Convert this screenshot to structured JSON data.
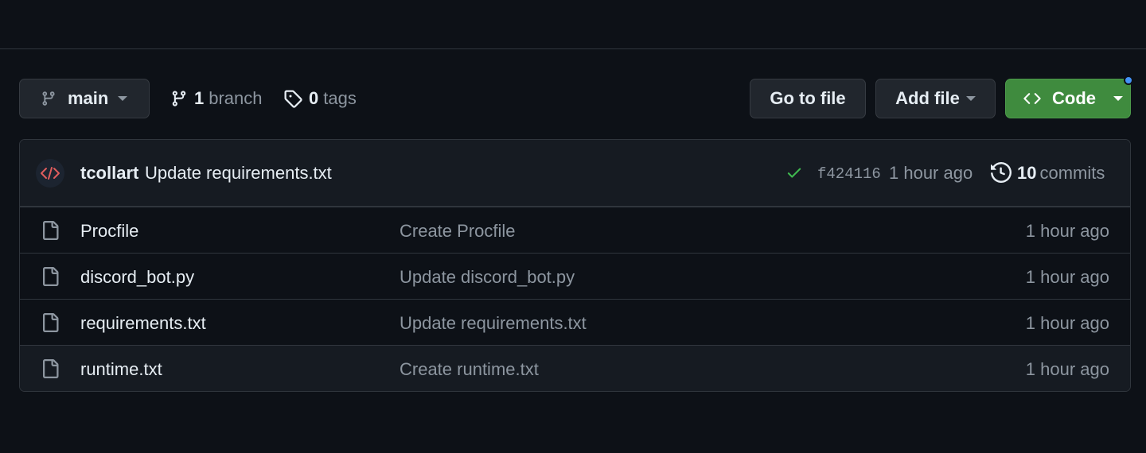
{
  "toolbar": {
    "branch_label": "main",
    "branch_count": "1",
    "branch_word": "branch",
    "tag_count": "0",
    "tag_word": "tags",
    "goto_label": "Go to file",
    "add_label": "Add file",
    "code_label": "Code"
  },
  "commit": {
    "author": "tcollart",
    "message": "Update requirements.txt",
    "sha": "f424116",
    "time": "1 hour ago",
    "commit_count": "10",
    "commit_word": "commits"
  },
  "files": [
    {
      "name": "Procfile",
      "message": "Create Procfile",
      "age": "1 hour ago"
    },
    {
      "name": "discord_bot.py",
      "message": "Update discord_bot.py",
      "age": "1 hour ago"
    },
    {
      "name": "requirements.txt",
      "message": "Update requirements.txt",
      "age": "1 hour ago"
    },
    {
      "name": "runtime.txt",
      "message": "Create runtime.txt",
      "age": "1 hour ago"
    }
  ],
  "colors": {
    "background": "#0d1117",
    "code_button": "#3f8b3e",
    "status_check": "#3fb950",
    "avatar_glyph": "#e05d5d",
    "notification_dot": "#4493f8"
  },
  "icons": [
    "git-branch-icon",
    "tag-icon",
    "code-brackets-icon",
    "check-icon",
    "history-icon",
    "file-icon"
  ]
}
